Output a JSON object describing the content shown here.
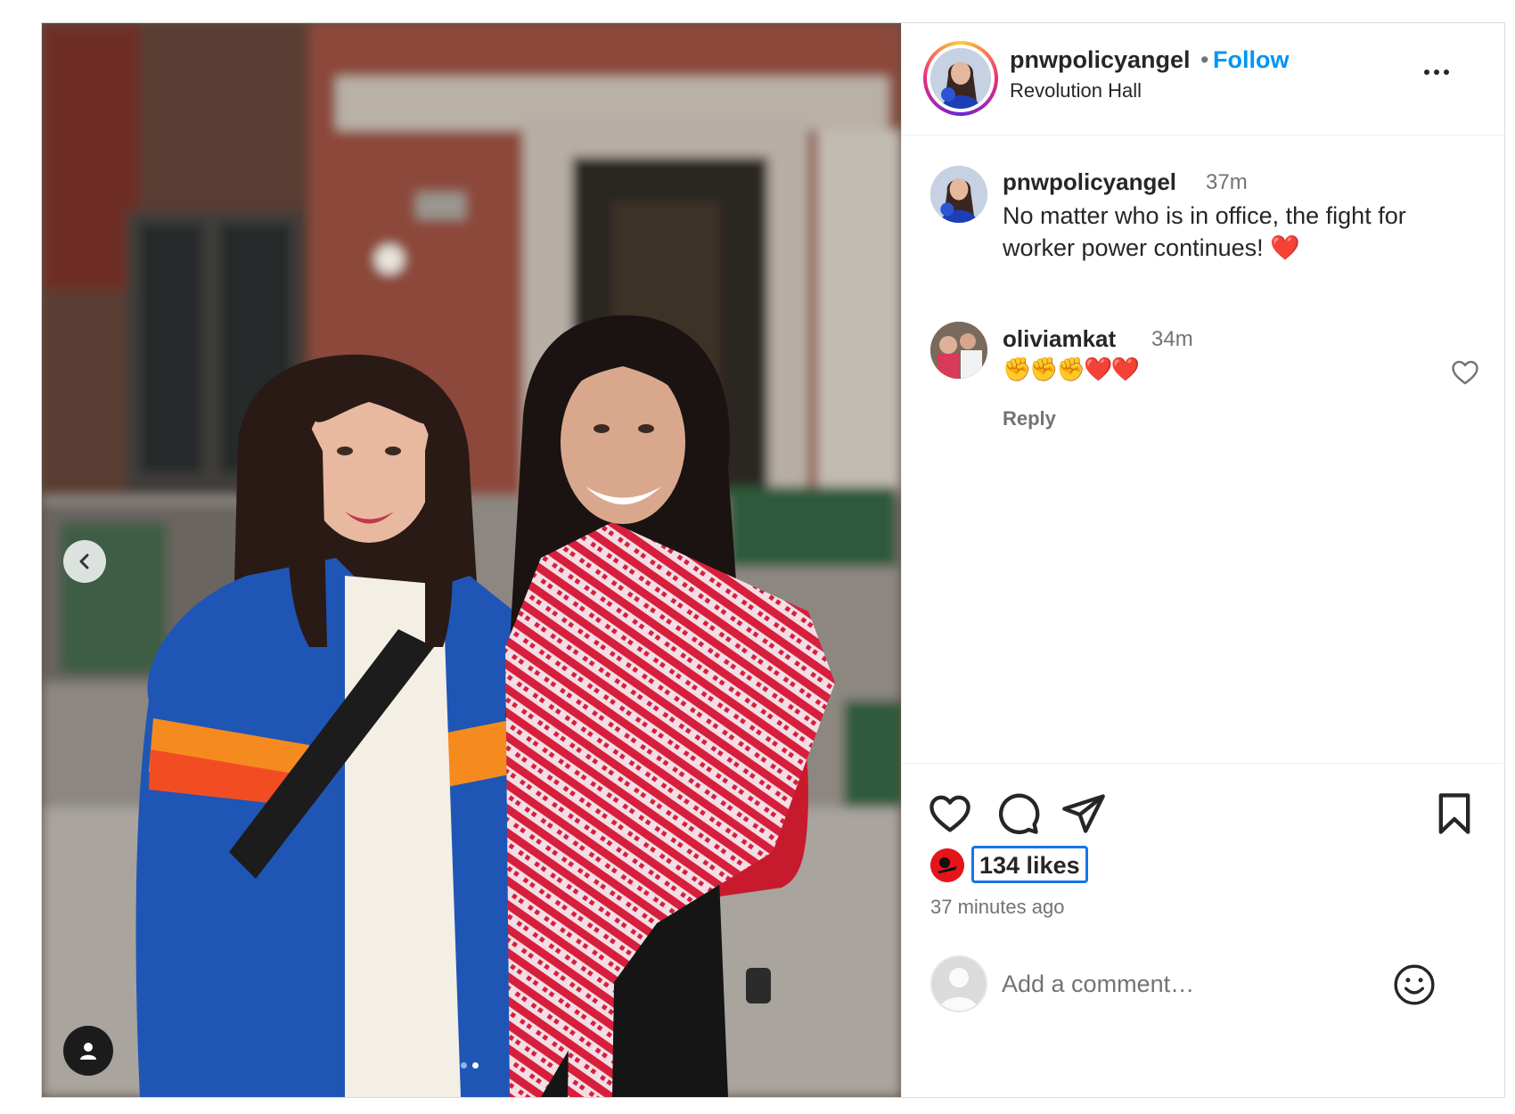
{
  "post": {
    "username": "pnwpolicyangel",
    "separator": "•",
    "follow_label": "Follow",
    "location": "Revolution Hall"
  },
  "caption": {
    "username": "pnwpolicyangel",
    "time": "37m",
    "text": "No matter who is in office, the fight for worker power continues! ❤️"
  },
  "comments": [
    {
      "username": "oliviamkat",
      "time": "34m",
      "text": "✊✊✊❤️❤️",
      "reply_label": "Reply"
    }
  ],
  "engagement": {
    "likes_label": "134 likes",
    "time_ago": "37 minutes ago"
  },
  "comment_box": {
    "placeholder": "Add a comment…"
  },
  "carousel": {
    "slide_count": 2,
    "active_index": 1
  },
  "icons": {
    "more": "more-horizontal-icon",
    "like": "heart-icon",
    "comment": "comment-bubble-icon",
    "share": "paper-plane-icon",
    "save": "bookmark-icon",
    "prev": "chevron-left-icon",
    "tags": "user-tag-icon",
    "emoji": "smiley-icon"
  },
  "colors": {
    "accent": "#0095f6",
    "text": "#262626",
    "muted": "#737373",
    "focus_ring": "#1a73e8"
  }
}
